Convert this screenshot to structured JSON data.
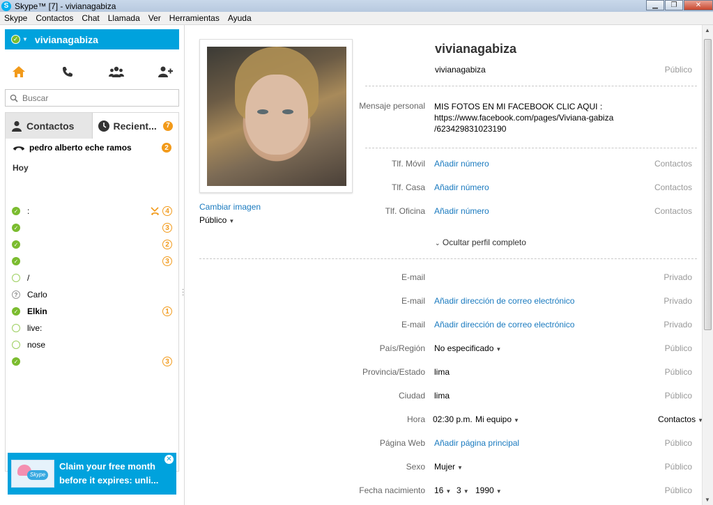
{
  "window": {
    "title": "Skype™ [7] - vivianagabiza",
    "logo": "S"
  },
  "menu": [
    "Skype",
    "Contactos",
    "Chat",
    "Llamada",
    "Ver",
    "Herramientas",
    "Ayuda"
  ],
  "user": {
    "name": "vivianagabiza"
  },
  "search": {
    "placeholder": "Buscar"
  },
  "tabs": {
    "contacts": "Contactos",
    "recent": "Recient...",
    "recent_badge": "7"
  },
  "recent_call": {
    "name": "pedro alberto eche ramos",
    "badge": "2"
  },
  "section_today": "Hoy",
  "contacts": [
    {
      "name": ":",
      "status": "online",
      "badge": "4",
      "missed_call": true
    },
    {
      "name": "",
      "status": "online",
      "badge": "3"
    },
    {
      "name": "",
      "status": "online",
      "badge": "2"
    },
    {
      "name": "",
      "status": "online",
      "badge": "3"
    },
    {
      "name": "/",
      "status": "offline",
      "badge": ""
    },
    {
      "name": "Carlo",
      "status": "unknown",
      "badge": ""
    },
    {
      "name": "Elkin",
      "status": "online",
      "badge": "1",
      "bold": true
    },
    {
      "name": "live:",
      "status": "offline",
      "badge": ""
    },
    {
      "name": "nose",
      "status": "offline",
      "badge": ""
    },
    {
      "name": "",
      "status": "online",
      "badge": "3"
    }
  ],
  "promo": {
    "text": "Claim your free month before it expires: unli...",
    "logo_text": "Skype"
  },
  "profile": {
    "name": "vivianagabiza",
    "username": "vivianagabiza",
    "username_visibility": "Público",
    "change_image": "Cambiar imagen",
    "image_visibility": "Público",
    "personal_message_label": "Mensaje personal",
    "personal_message_lines": [
      "MIS FOTOS EN MI FACEBOOK CLIC AQUI :",
      "https://www.facebook.com/pages/Viviana-gabiza",
      "/623429831023190"
    ],
    "phones": [
      {
        "label": "Tlf. Móvil",
        "value": "Añadir número",
        "visibility": "Contactos"
      },
      {
        "label": "Tlf. Casa",
        "value": "Añadir número",
        "visibility": "Contactos"
      },
      {
        "label": "Tlf. Oficina",
        "value": "Añadir número",
        "visibility": "Contactos"
      }
    ],
    "toggle_label": "Ocultar perfil completo",
    "emails": [
      {
        "label": "E-mail",
        "value": "",
        "visibility": "Privado"
      },
      {
        "label": "E-mail",
        "value": "Añadir dirección de correo electrónico",
        "visibility": "Privado"
      },
      {
        "label": "E-mail",
        "value": "Añadir dirección de correo electrónico",
        "visibility": "Privado"
      }
    ],
    "country": {
      "label": "País/Región",
      "value": "No especificado",
      "visibility": "Público"
    },
    "province": {
      "label": "Provincia/Estado",
      "value": "lima",
      "visibility": "Público"
    },
    "city": {
      "label": "Ciudad",
      "value": "lima",
      "visibility": "Público"
    },
    "time": {
      "label": "Hora",
      "value": "02:30 p.m.",
      "tz": "Mi equipo",
      "visibility": "Contactos"
    },
    "website": {
      "label": "Página Web",
      "value": "Añadir página principal",
      "visibility": "Público"
    },
    "gender": {
      "label": "Sexo",
      "value": "Mujer",
      "visibility": "Público"
    },
    "birthdate": {
      "label": "Fecha nacimiento",
      "day": "16",
      "month": "3",
      "year": "1990",
      "visibility": "Público"
    }
  },
  "colors": {
    "skype_blue": "#00a2dd",
    "link": "#1a7abf",
    "badge_orange": "#f29a1a",
    "online_green": "#7bbc2f"
  }
}
